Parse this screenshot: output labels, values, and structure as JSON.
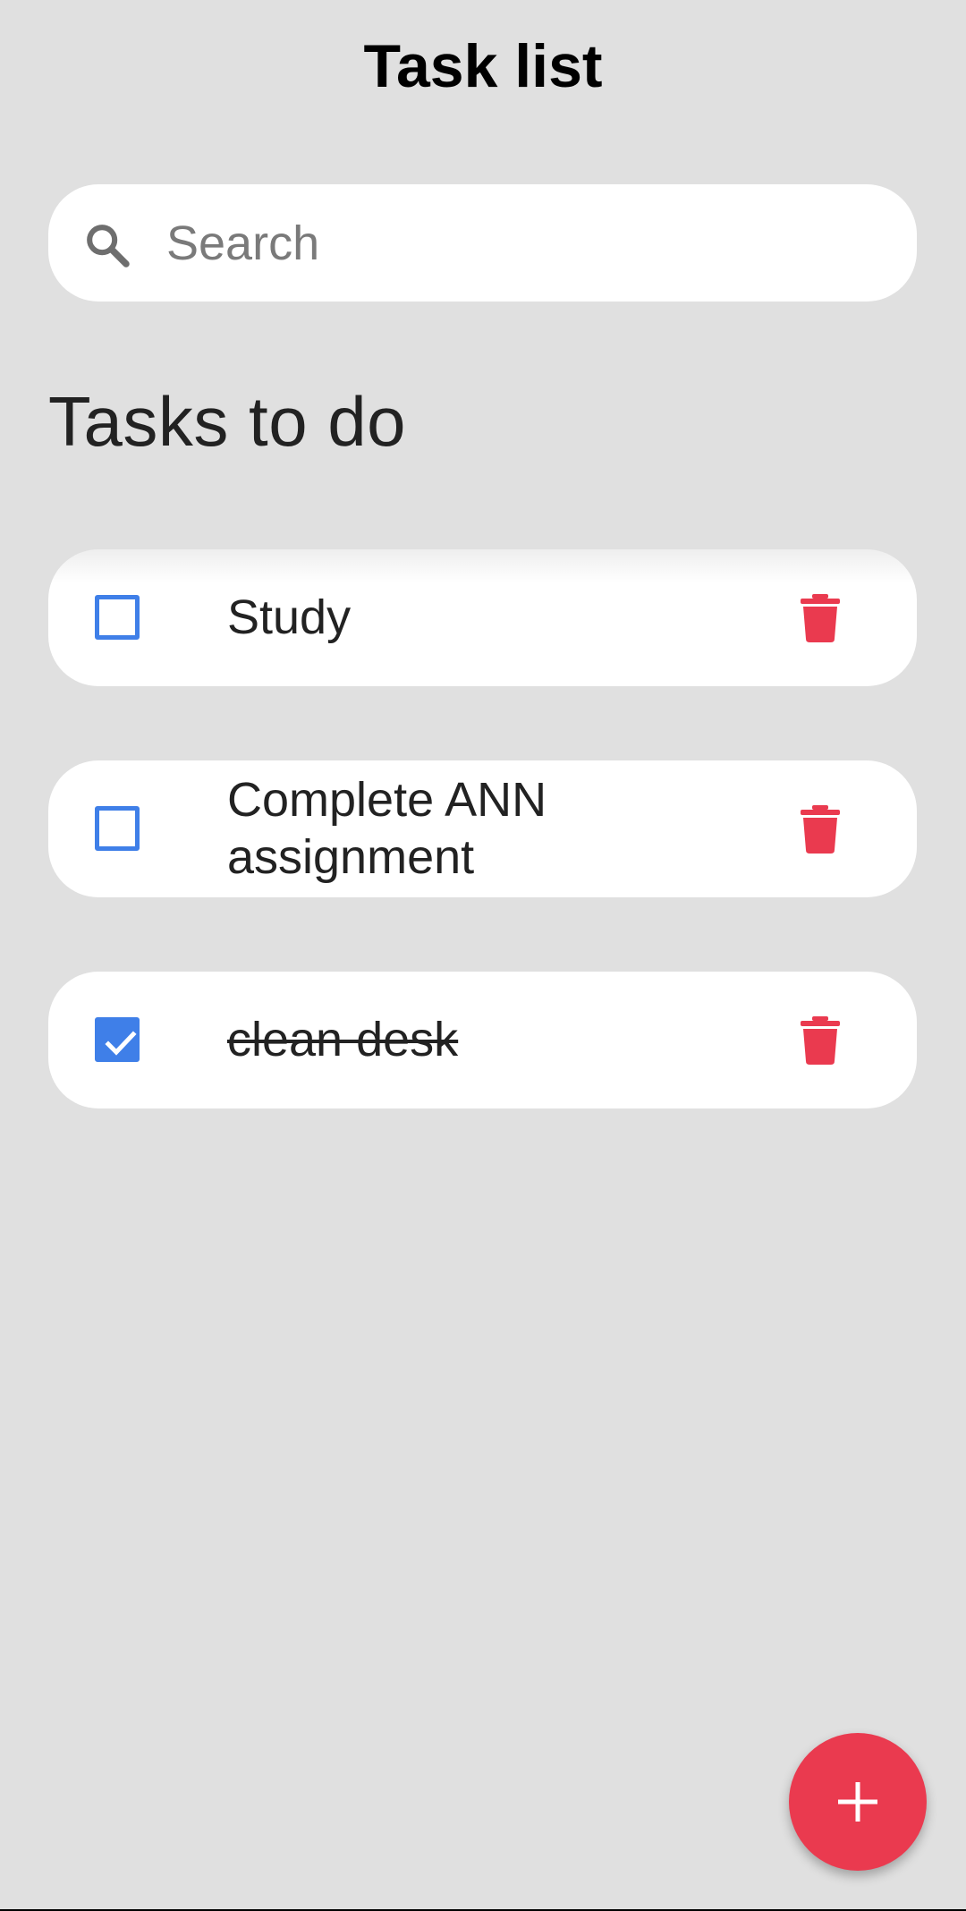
{
  "header": {
    "title": "Task list"
  },
  "search": {
    "placeholder": "Search",
    "value": "",
    "icon": "search-icon"
  },
  "section": {
    "heading": "Tasks to do"
  },
  "tasks": [
    {
      "label": "Study",
      "checked": false
    },
    {
      "label": "Complete ANN assignment",
      "checked": false
    },
    {
      "label": "clean desk",
      "checked": true
    }
  ],
  "fab": {
    "label": "+",
    "icon": "plus-icon"
  },
  "colors": {
    "background": "#e0e0e0",
    "card": "#ffffff",
    "checkbox": "#3f7fe8",
    "delete": "#ea3a4f",
    "fab": "#ea3a4f"
  }
}
